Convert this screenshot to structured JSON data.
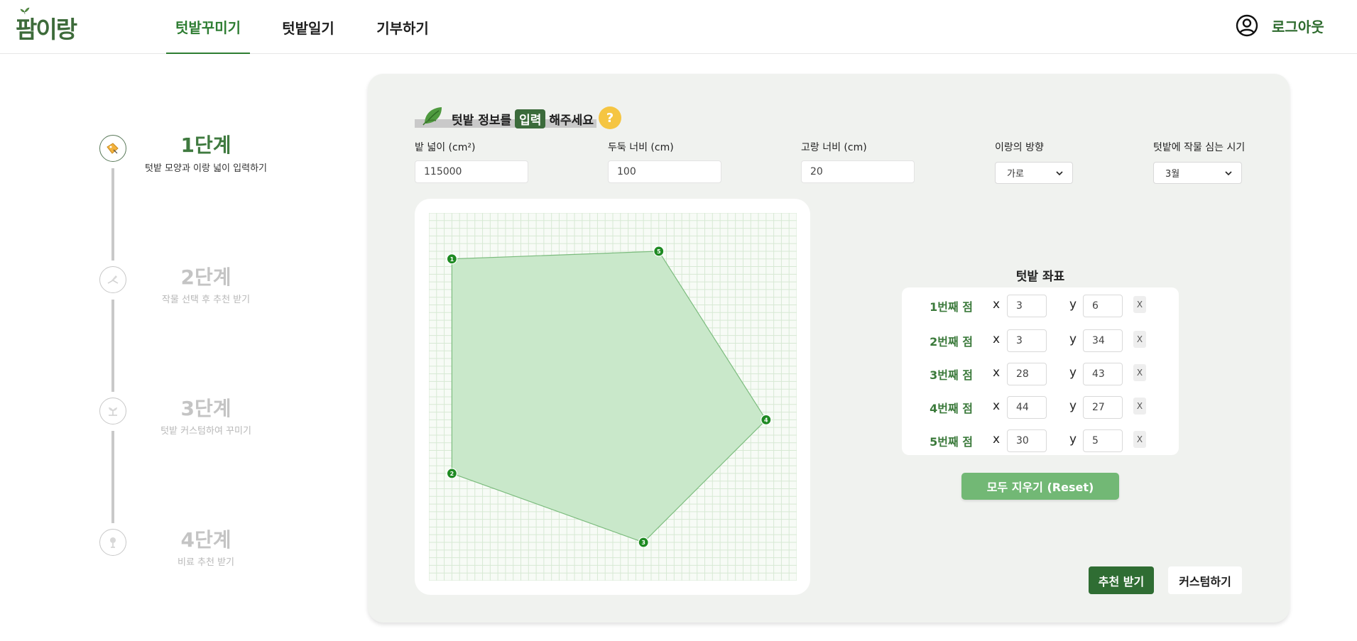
{
  "header": {
    "logo": "팜이랑",
    "nav": [
      {
        "label": "텃밭꾸미기",
        "active": true
      },
      {
        "label": "텃밭일기",
        "active": false
      },
      {
        "label": "기부하기",
        "active": false
      }
    ],
    "logout": "로그아웃"
  },
  "steps": [
    {
      "title": "1단계",
      "subtitle": "텃밭 모양과 이랑 넓이 입력하기",
      "active": true
    },
    {
      "title": "2단계",
      "subtitle": "작물 선택 후 추천 받기",
      "active": false
    },
    {
      "title": "3단계",
      "subtitle": "텃밭 커스텀하여 꾸미기",
      "active": false
    },
    {
      "title": "4단계",
      "subtitle": "비료 추천 받기",
      "active": false
    }
  ],
  "section": {
    "title_before": "텃밭 정보를",
    "title_badge": "입력",
    "title_after": "해주세요",
    "help": "?"
  },
  "fields": {
    "area_label": "밭 넓이 (cm²)",
    "area_value": "115000",
    "ridge_label": "두둑 너비 (cm)",
    "ridge_value": "100",
    "furrow_label": "고랑 너비 (cm)",
    "furrow_value": "20",
    "direction_label": "이랑의 방향",
    "direction_value": "가로",
    "planting_label": "텃밭에 작물 심는 시기",
    "planting_value": "3월"
  },
  "grid": {
    "cells": 48,
    "polygon": [
      {
        "id": "1",
        "x": 3,
        "y": 6
      },
      {
        "id": "5",
        "x": 30,
        "y": 5
      },
      {
        "id": "4",
        "x": 44,
        "y": 27
      },
      {
        "id": "3",
        "x": 28,
        "y": 43
      },
      {
        "id": "2",
        "x": 3,
        "y": 34
      }
    ],
    "fill": "#c9e8ca",
    "stroke": "#7cbc7e",
    "point_color": "#1e8a22"
  },
  "coords": {
    "title": "텃밭 좌표",
    "points": [
      {
        "label": "1번째 점",
        "x": "3",
        "y": "6"
      },
      {
        "label": "2번째 점",
        "x": "3",
        "y": "34"
      },
      {
        "label": "3번째 점",
        "x": "28",
        "y": "43"
      },
      {
        "label": "4번째 점",
        "x": "44",
        "y": "27"
      },
      {
        "label": "5번째 점",
        "x": "30",
        "y": "5"
      }
    ],
    "x_axis": "x",
    "y_axis": "y",
    "delete": "X"
  },
  "buttons": {
    "reset": "모두 지우기 (Reset)",
    "recommend": "추천 받기",
    "customize": "커스텀하기"
  },
  "colors": {
    "primary": "#2f6d33",
    "accent": "#3f7a3f",
    "reset": "#72b875",
    "help": "#f5c542",
    "panel": "#f0f2ef"
  }
}
